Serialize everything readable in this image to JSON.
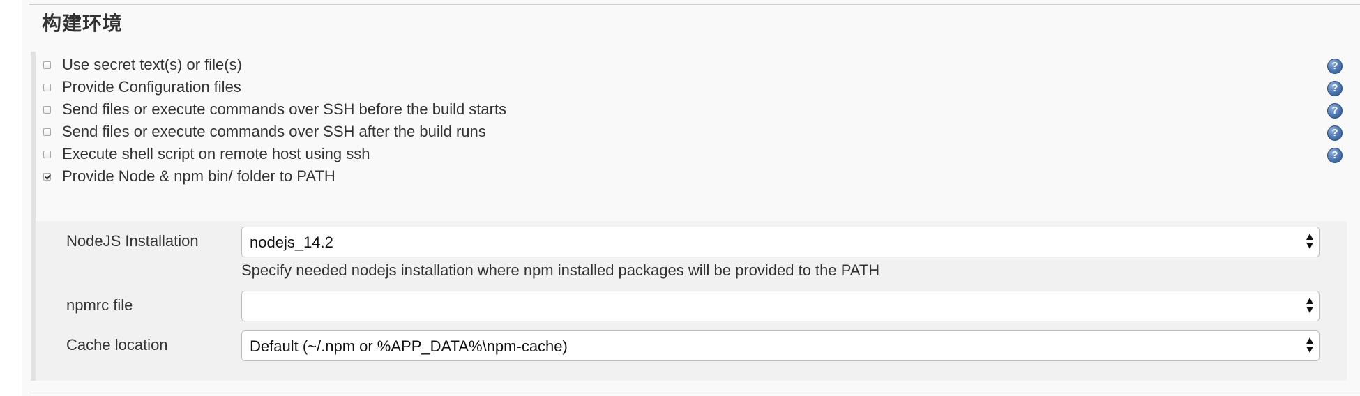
{
  "section": {
    "title": "构建环境"
  },
  "options": [
    {
      "label": "Use secret text(s) or file(s)",
      "checked": false,
      "help": true
    },
    {
      "label": "Provide Configuration files",
      "checked": false,
      "help": true
    },
    {
      "label": "Send files or execute commands over SSH before the build starts",
      "checked": false,
      "help": true
    },
    {
      "label": "Send files or execute commands over SSH after the build runs",
      "checked": false,
      "help": true
    },
    {
      "label": "Execute shell script on remote host using ssh",
      "checked": false,
      "help": true
    },
    {
      "label": "Provide Node & npm bin/ folder to PATH",
      "checked": true,
      "help": false
    }
  ],
  "node_config": {
    "nodejs_installation": {
      "label": "NodeJS Installation",
      "value": "nodejs_14.2",
      "description": "Specify needed nodejs installation where npm installed packages will be provided to the PATH"
    },
    "npmrc_file": {
      "label": "npmrc file",
      "value": ""
    },
    "cache_location": {
      "label": "Cache location",
      "value": "Default (~/.npm or %APP_DATA%\\npm-cache)"
    }
  },
  "icons": {
    "help": "help-icon",
    "checkbox": "checkbox-icon",
    "select_arrows": "select-arrows-icon"
  },
  "colors": {
    "panel_background": "#f9f9f9",
    "nested_background": "#f1f1f1",
    "help_icon_blue": "#4c74ad",
    "text": "#333333"
  }
}
